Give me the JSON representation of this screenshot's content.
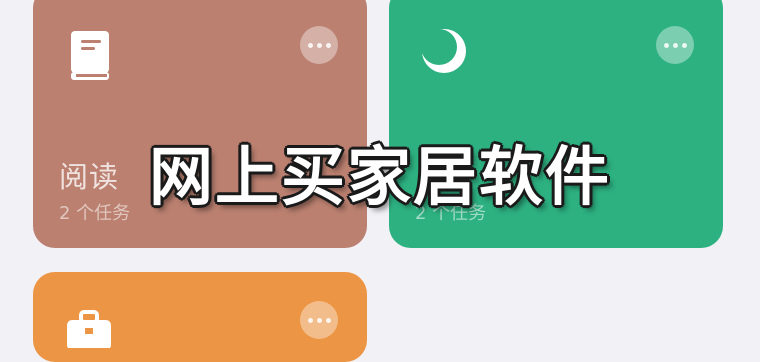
{
  "colors": {
    "reading_card": "#bb8070",
    "night_card": "#2db181",
    "work_card": "#eb9545",
    "background": "#f2f2f6"
  },
  "cards": [
    {
      "title": "阅读",
      "subtitle": "2 个任务",
      "icon": "book-icon"
    },
    {
      "title": "",
      "subtitle": "2 个任务",
      "icon": "moon-icon"
    },
    {
      "title": "",
      "subtitle": "",
      "icon": "briefcase-icon"
    }
  ],
  "overlay": {
    "text": "网上买家居软件"
  }
}
